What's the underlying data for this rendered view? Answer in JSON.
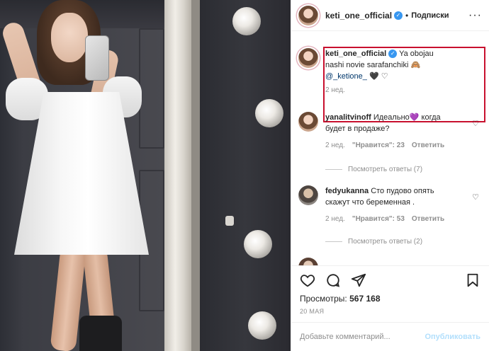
{
  "header": {
    "username": "keti_one_official",
    "separator": "•",
    "follow_label": "Подписки",
    "more_label": "···"
  },
  "caption": {
    "username": "keti_one_official",
    "text": "Ya obojau nashi novie sarafanchiki 🙈",
    "mention": "@_ketione_",
    "emoji_end": "🖤 ♡",
    "time": "2 нед."
  },
  "comments": [
    {
      "username": "yanalitvinoff",
      "text": "Идеально💜 когда будет в продаже?",
      "time": "2 нед.",
      "likes": "\"Нравится\": 23",
      "reply": "Ответить",
      "view_replies": "Посмотреть ответы (7)"
    },
    {
      "username": "fedyukanna",
      "text": "Сто пудово опять скажут что беременная .",
      "time": "2 нед.",
      "likes": "\"Нравится\": 53",
      "reply": "Ответить",
      "view_replies": "Посмотреть ответы (2)"
    }
  ],
  "stats": {
    "views_label": "Просмотры:",
    "views_count": "567 168",
    "date": "20 МАЯ"
  },
  "add_comment": {
    "placeholder": "Добавьте комментарий...",
    "publish_label": "Опубликовать"
  },
  "colors": {
    "highlight": "#c8102e",
    "verified": "#3897f0",
    "publish_disabled": "#b2dffc"
  }
}
